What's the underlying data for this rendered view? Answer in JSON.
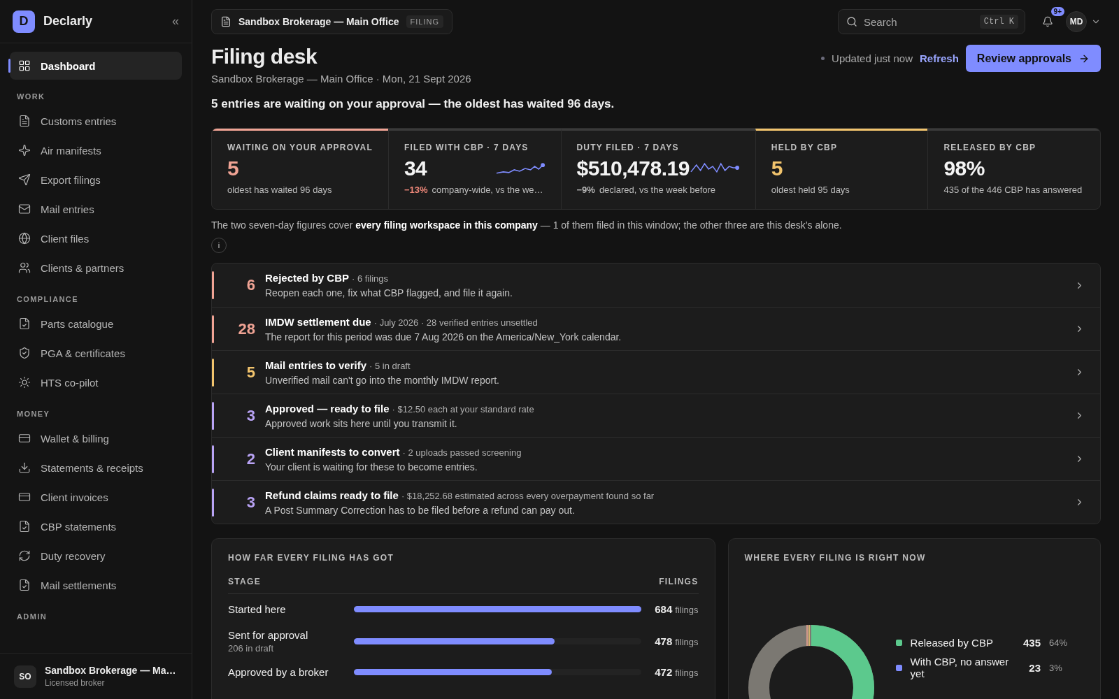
{
  "brand": {
    "logo": "D",
    "name": "Declarly",
    "collapse": "«"
  },
  "sidebar": {
    "sections": [
      {
        "items": [
          {
            "label": "Dashboard",
            "selected": true
          }
        ]
      },
      {
        "heading": "WORK",
        "items": [
          {
            "label": "Customs entries",
            "selected": false
          },
          {
            "label": "Air manifests",
            "selected": false
          },
          {
            "label": "Export filings",
            "selected": false
          },
          {
            "label": "Mail entries",
            "selected": false
          },
          {
            "label": "Client files",
            "selected": false
          },
          {
            "label": "Clients & partners",
            "selected": false
          }
        ]
      },
      {
        "heading": "COMPLIANCE",
        "items": [
          {
            "label": "Parts catalogue",
            "selected": false
          },
          {
            "label": "PGA & certificates",
            "selected": false
          },
          {
            "label": "HTS co-pilot",
            "selected": false
          }
        ]
      },
      {
        "heading": "MONEY",
        "items": [
          {
            "label": "Wallet & billing",
            "selected": false
          },
          {
            "label": "Statements & receipts",
            "selected": false
          },
          {
            "label": "Client invoices",
            "selected": false
          },
          {
            "label": "CBP statements",
            "selected": false
          },
          {
            "label": "Duty recovery",
            "selected": false
          },
          {
            "label": "Mail settlements",
            "selected": false
          }
        ]
      },
      {
        "heading": "ADMIN"
      }
    ],
    "account": {
      "initials": "SO",
      "name": "Sandbox Brokerage — Ma…",
      "role": "Licensed broker"
    }
  },
  "topbar": {
    "workspace": "Sandbox Brokerage — Main Office",
    "badge": "FILING",
    "search": {
      "placeholder": "Search",
      "shortcut": "Ctrl K"
    },
    "notifications": "9+",
    "user": "MD"
  },
  "header": {
    "title": "Filing desk",
    "subtitle": "Sandbox Brokerage — Main Office · Mon, 21 Sept 2026",
    "status": "Updated just now",
    "refresh": "Refresh",
    "action": "Review approvals",
    "summary": "5 entries are waiting on your approval — the oldest has waited 96 days."
  },
  "kpis": [
    {
      "kind": "alert",
      "color": "#f0a394",
      "label": "WAITING ON YOUR APPROVAL",
      "value": "5",
      "note": "oldest has waited 96 days"
    },
    {
      "kind": "trend",
      "color": "#3a3a3a",
      "label": "FILED WITH CBP · 7 DAYS",
      "value": "34",
      "delta": {
        "text": "−13%",
        "color": "#f0887a"
      },
      "note": "company-wide, vs the we…"
    },
    {
      "kind": "trend",
      "color": "#3a3a3a",
      "label": "DUTY FILED · 7 DAYS",
      "value": "$510,478.19",
      "delta": {
        "text": "−9%",
        "color": "#b8b8b8"
      },
      "note": "declared, vs the week before"
    },
    {
      "kind": "alert",
      "color": "#f2c46d",
      "label": "HELD BY CBP",
      "value": "5",
      "note": "oldest held 95 days"
    },
    {
      "kind": "plain",
      "color": "#3a3a3a",
      "label": "RELEASED BY CBP",
      "value": "98%",
      "note": "435 of the 446 CBP has answered"
    }
  ],
  "footnote": "The two seven-day figures cover **every filing workspace in this company** — 1 of them filed in this window; the other three are this desk’s alone.",
  "info": "i",
  "tasks": [
    {
      "color": "#f0a394",
      "count": "6",
      "title": "Rejected by CBP",
      "meta": "· 6 filings",
      "description": "Reopen each one, fix what CBP flagged, and file it again."
    },
    {
      "color": "#f0a394",
      "count": "28",
      "title": "IMDW settlement due",
      "meta": "· July 2026 · 28 verified entries unsettled",
      "description": "The report for this period was due 7 Aug 2026 on the America/New_York calendar."
    },
    {
      "color": "#f2c46d",
      "count": "5",
      "title": "Mail entries to verify",
      "meta": "· 5 in draft",
      "description": "Unverified mail can't go into the monthly IMDW report."
    },
    {
      "color": "#b9a3f5",
      "count": "3",
      "title": "Approved — ready to file",
      "meta": "· $12.50 each at your standard rate",
      "description": "Approved work sits here until you transmit it."
    },
    {
      "color": "#b9a3f5",
      "count": "2",
      "title": "Client manifests to convert",
      "meta": "· 2 uploads passed screening",
      "description": "Your client is waiting for these to become entries."
    },
    {
      "color": "#b9a3f5",
      "count": "3",
      "title": "Refund claims ready to file",
      "meta": "· $18,252.68 estimated across every overpayment found so far",
      "description": "A Post Summary Correction has to be filed before a refund can pay out."
    }
  ],
  "stages": {
    "title": "HOW FAR EVERY FILING HAS GOT",
    "columns": [
      "STAGE",
      "FILINGS"
    ],
    "rows": [
      {
        "label": "Started here",
        "level": 1.0,
        "count": "684",
        "unit": "filings"
      },
      {
        "label": "Sent for approval",
        "sub": "206 in draft",
        "level": 0.7,
        "count": "478",
        "unit": "filings"
      },
      {
        "label": "Approved by a broker",
        "level": 0.69,
        "count": "472",
        "unit": "filings"
      }
    ]
  },
  "status": {
    "title": "WHERE EVERY FILING IS RIGHT NOW",
    "legend": [
      {
        "color": "#5cc98d",
        "label": "Released by CBP",
        "count": "435",
        "share": "64%"
      },
      {
        "color": "#7f8cff",
        "label": "With CBP, no answer yet",
        "count": "23",
        "share": "3%"
      }
    ]
  }
}
